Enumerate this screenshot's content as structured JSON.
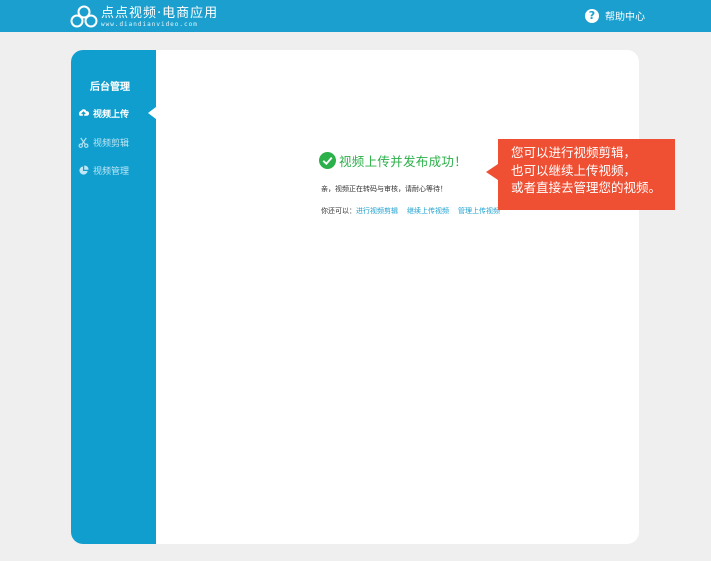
{
  "header": {
    "logo_title": "点点视频·电商应用",
    "logo_url": "www.diandianvideo.com",
    "help_label": "帮助中心"
  },
  "sidebar": {
    "title": "后台管理",
    "items": [
      {
        "label": "视频上传",
        "icon": "upload-icon",
        "active": true
      },
      {
        "label": "视频剪辑",
        "icon": "scissors-icon",
        "active": false
      },
      {
        "label": "视频管理",
        "icon": "pie-chart-icon",
        "active": false
      }
    ]
  },
  "main": {
    "success_title": "视频上传并发布成功！",
    "notice": "亲，视频正在转码与审核，请耐心等待！",
    "actions_prefix": "你还可以：",
    "links": [
      "进行视频剪辑",
      "继续上传视频",
      "管理上传视频"
    ]
  },
  "tooltip": {
    "lines": [
      "您可以进行视频剪辑，",
      "也可以继续上传视频，",
      "或者直接去管理您的视频。"
    ]
  },
  "colors": {
    "topbar": "#1a9fcf",
    "sidebar": "#109ece",
    "success": "#2bb04a",
    "tooltip": "#ef4f33",
    "link": "#1a9fcf"
  }
}
